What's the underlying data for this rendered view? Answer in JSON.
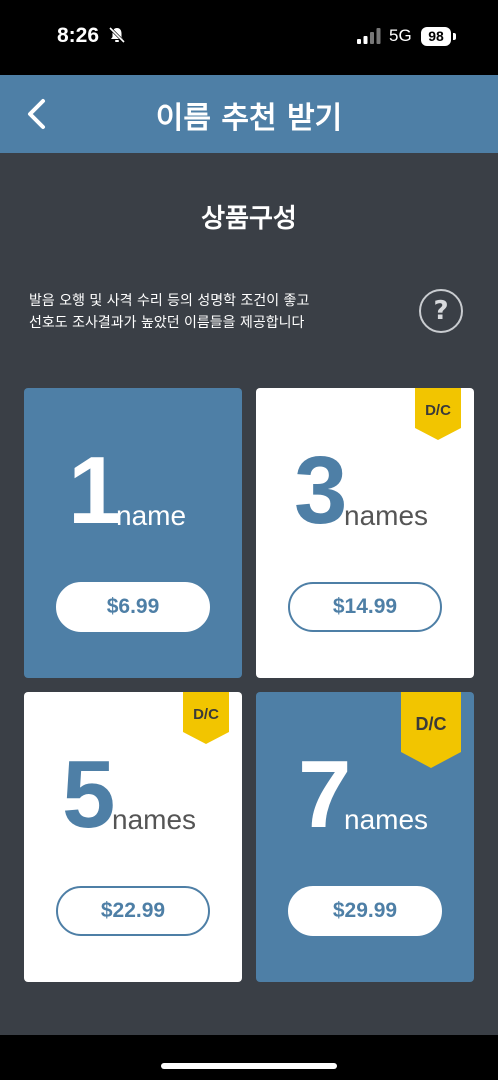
{
  "status": {
    "time": "8:26",
    "network": "5G",
    "battery": "98"
  },
  "nav": {
    "title": "이름 추천 받기"
  },
  "section": {
    "title": "상품구성"
  },
  "description": {
    "line1": "발음 오행 및 사격 수리 등의 성명학 조건이 좋고",
    "line2": "선호도 조사결과가 높았던 이름들을 제공합니다"
  },
  "help": {
    "label": "?"
  },
  "products": [
    {
      "count": "1",
      "unit": "name",
      "price": "$6.99",
      "badge": ""
    },
    {
      "count": "3",
      "unit": "names",
      "price": "$14.99",
      "badge": "D/C"
    },
    {
      "count": "5",
      "unit": "names",
      "price": "$22.99",
      "badge": "D/C"
    },
    {
      "count": "7",
      "unit": "names",
      "price": "$29.99",
      "badge": "D/C"
    }
  ],
  "colors": {
    "primary": "#4e7fa6",
    "badge": "#f2c500",
    "background": "#3a3f46"
  }
}
